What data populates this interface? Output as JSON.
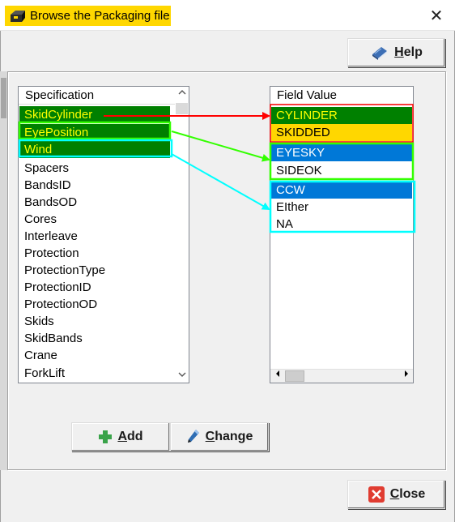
{
  "window": {
    "title": "Browse the Packaging file",
    "close_glyph": "✕"
  },
  "buttons": {
    "help": {
      "label_underlined": "H",
      "label_rest": "elp",
      "icon": "book-icon"
    },
    "add": {
      "label_underlined": "A",
      "label_rest": "dd",
      "icon": "plus-icon"
    },
    "change": {
      "label_underlined": "C",
      "label_rest": "hange",
      "icon": "pencil-icon"
    },
    "close": {
      "label_underlined": "C",
      "label_rest": "lose",
      "icon": "red-x-icon"
    }
  },
  "spec_list": {
    "header": "Specification",
    "items": [
      {
        "label": "SkidCylinder",
        "selected": true
      },
      {
        "label": "EyePosition",
        "selected": true
      },
      {
        "label": "Wind",
        "selected": true
      },
      {
        "label": "Spacers"
      },
      {
        "label": "BandsID"
      },
      {
        "label": "BandsOD"
      },
      {
        "label": "Cores"
      },
      {
        "label": "Interleave"
      },
      {
        "label": "Protection"
      },
      {
        "label": "ProtectionType"
      },
      {
        "label": "ProtectionID"
      },
      {
        "label": "ProtectionOD"
      },
      {
        "label": "Skids"
      },
      {
        "label": "SkidBands"
      },
      {
        "label": "Crane"
      },
      {
        "label": "ForkLift"
      }
    ]
  },
  "value_list": {
    "header": "Field Value",
    "items": [
      {
        "label": "CYLINDER",
        "state": "selected-green"
      },
      {
        "label": "SKIDDED",
        "state": "yellow"
      },
      {
        "label": "EYESKY",
        "state": "selected-blue"
      },
      {
        "label": "SIDEOK",
        "state": "normal"
      },
      {
        "label": "CCW",
        "state": "selected-blue"
      },
      {
        "label": "EIther",
        "state": "normal"
      },
      {
        "label": "NA",
        "state": "normal"
      }
    ]
  },
  "colors": {
    "title_highlight": "#ffd700",
    "selected_green_bg": "#008000",
    "selected_green_text": "#ffff00",
    "yellow_bg": "#ffd700",
    "selected_blue_bg": "#0078d7",
    "annot_red": "#ff0000",
    "annot_green": "#33ff00",
    "annot_cyan": "#00ffff"
  }
}
